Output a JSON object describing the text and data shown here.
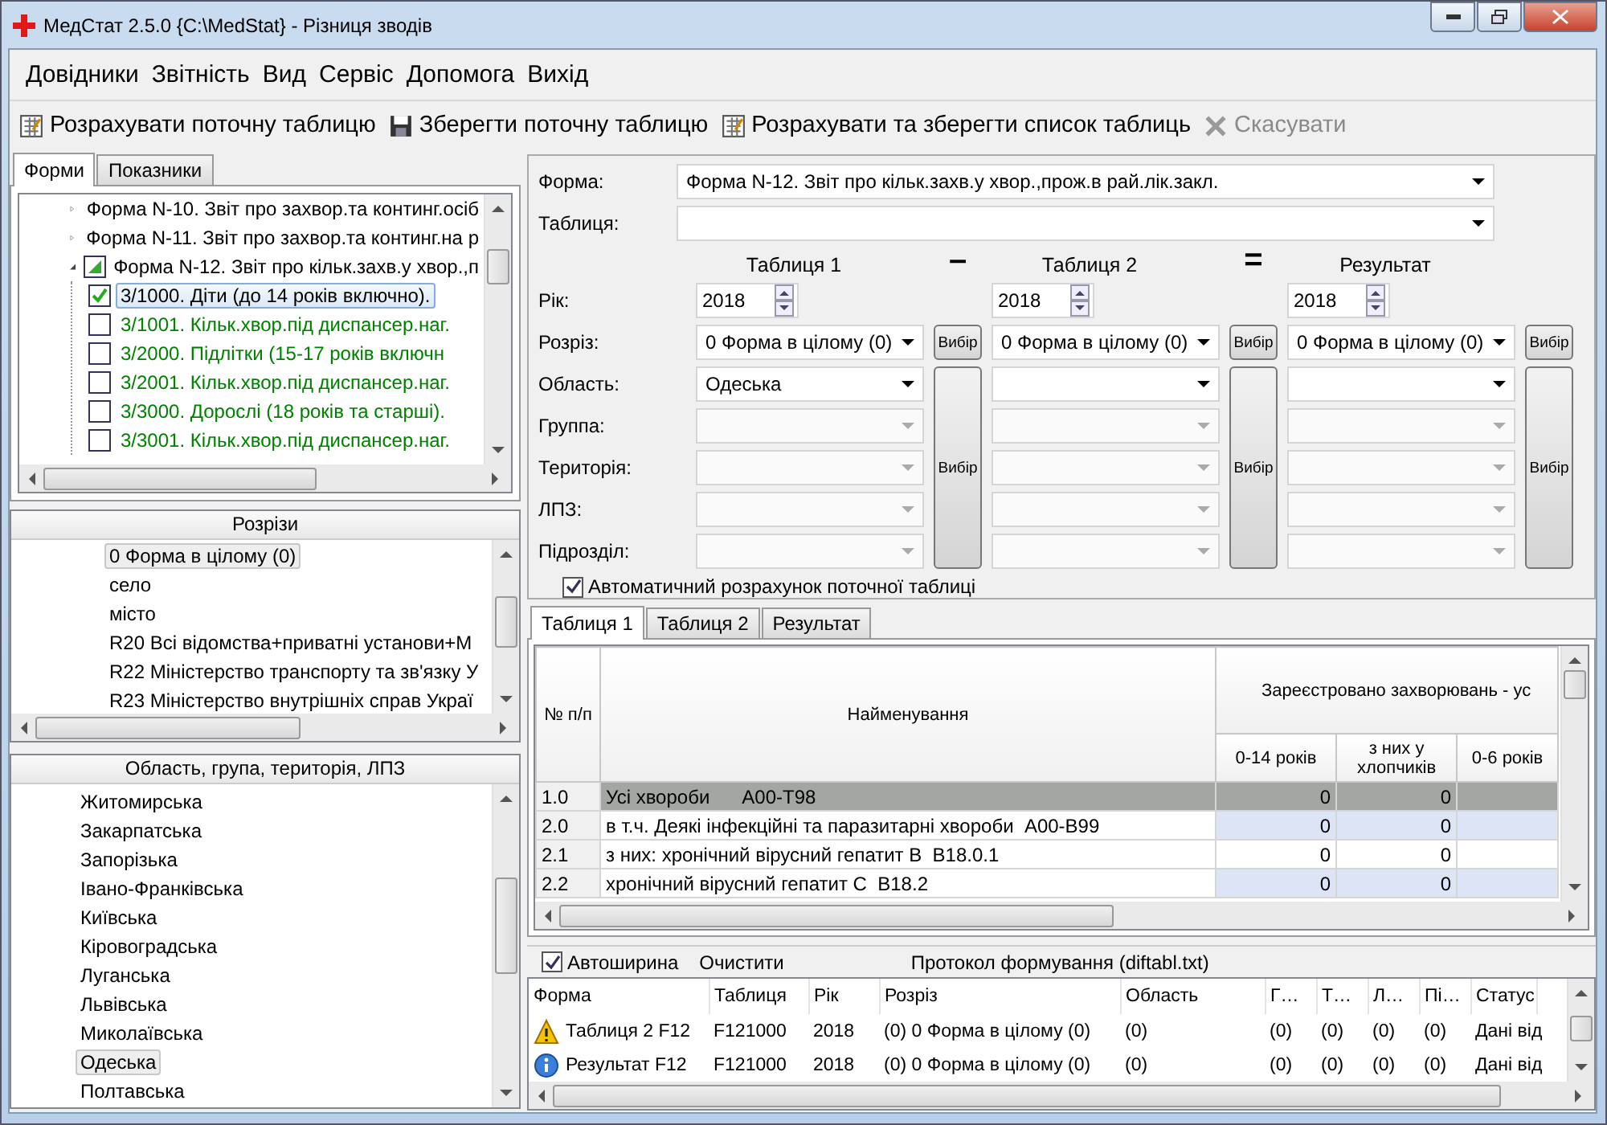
{
  "window": {
    "title": "МедСтат 2.5.0  {C:\\MedStat} - Різниця зводів"
  },
  "menu": [
    "Довідники",
    "Звітність",
    "Вид",
    "Сервіс",
    "Допомога",
    "Вихід"
  ],
  "toolbar": [
    {
      "kind": "calculate",
      "label": "Розрахувати поточну таблицю",
      "disabled": false
    },
    {
      "kind": "save",
      "label": "Зберегти поточну таблицю",
      "disabled": false
    },
    {
      "kind": "calculate",
      "label": "Розрахувати та зберегти список таблиць",
      "disabled": false
    },
    {
      "kind": "cancel",
      "label": "Скасувати",
      "disabled": true
    }
  ],
  "left_tabs": [
    {
      "label": "Форми",
      "selected": true
    },
    {
      "label": "Показники",
      "selected": false
    }
  ],
  "forms_tree": [
    {
      "label": "Форма N-10. Звіт про захвор.та континг.осіб",
      "expanded": false
    },
    {
      "label": "Форма N-11. Звіт про захвор.та континг.на р",
      "expanded": false
    },
    {
      "label": "Форма N-12. Звіт про кільк.захв.у хвор.,п",
      "expanded": true,
      "partial": true,
      "children": [
        {
          "label": "3/1000. Діти (до 14 років включно).",
          "checked": true,
          "selected": true,
          "color": "#000000"
        },
        {
          "label": "3/1001. Кільк.хвор.під диспансер.наг.",
          "checked": false,
          "selected": false,
          "color": "#008000"
        },
        {
          "label": "3/2000. Підлітки (15-17 років включн",
          "checked": false,
          "selected": false,
          "color": "#008000"
        },
        {
          "label": "3/2001. Кільк.хвор.під диспансер.наг.",
          "checked": false,
          "selected": false,
          "color": "#008000"
        },
        {
          "label": "3/3000. Дорослі (18 років та старші).",
          "checked": false,
          "selected": false,
          "color": "#008000"
        },
        {
          "label": "3/3001. Кільк.хвор.під диспансер.наг.",
          "checked": false,
          "selected": false,
          "color": "#008000"
        }
      ]
    }
  ],
  "slices": {
    "title": "Розрізи",
    "items": [
      {
        "label": "0 Форма в цілому (0)",
        "selected": true
      },
      {
        "label": "село",
        "selected": false
      },
      {
        "label": "місто",
        "selected": false
      },
      {
        "label": "R20 Всі відомства+приватні установи+М",
        "selected": false
      },
      {
        "label": "R22 Міністерство транспорту та зв'язку У",
        "selected": false
      },
      {
        "label": "R23 Міністерство внутрішніх справ Украї",
        "selected": false
      }
    ]
  },
  "regions": {
    "title": "Область, група, територія, ЛПЗ",
    "items": [
      {
        "label": "Житомирська",
        "selected": false
      },
      {
        "label": "Закарпатська",
        "selected": false
      },
      {
        "label": "Запорізька",
        "selected": false
      },
      {
        "label": "Івано-Франківська",
        "selected": false
      },
      {
        "label": "Київська",
        "selected": false
      },
      {
        "label": "Кіровоградська",
        "selected": false
      },
      {
        "label": "Луганська",
        "selected": false
      },
      {
        "label": "Львівська",
        "selected": false
      },
      {
        "label": "Миколаївська",
        "selected": false
      },
      {
        "label": "Одеська",
        "selected": true
      },
      {
        "label": "Полтавська",
        "selected": false
      }
    ]
  },
  "form": {
    "form_label": "Форма:",
    "form_value": "Форма N-12. Звіт про кільк.захв.у хвор.,прож.в рай.лік.закл.",
    "table_label": "Таблиця:"
  },
  "compare": {
    "operators": [
      "–",
      "="
    ],
    "labels": [
      "Рік:",
      "Розріз:",
      "Область:",
      "Группа:",
      "Територія:",
      "ЛПЗ:",
      "Підрозділ:"
    ],
    "columns": [
      {
        "title": "Таблиця 1",
        "year": "2018",
        "slice": "0 Форма в цілому (0)",
        "slice_button": "Вибір",
        "select_button": "Вибір",
        "fields": [
          {
            "value": "Одеська",
            "disabled": false
          },
          {
            "disabled": true
          },
          {
            "disabled": true
          },
          {
            "disabled": true
          },
          {
            "disabled": true
          }
        ]
      },
      {
        "title": "Таблиця 2",
        "year": "2018",
        "slice": "0 Форма в цілому (0)",
        "slice_button": "Вибір",
        "select_button": "Вибір",
        "fields": [
          {
            "disabled": false
          },
          {
            "disabled": true
          },
          {
            "disabled": true
          },
          {
            "disabled": true
          },
          {
            "disabled": true
          }
        ]
      },
      {
        "title": "Результат",
        "year": "2018",
        "slice": "0 Форма в цілому (0)",
        "slice_button": "Вибір",
        "select_button": "Вибір",
        "fields": [
          {
            "disabled": false
          },
          {
            "disabled": true
          },
          {
            "disabled": true
          },
          {
            "disabled": true
          },
          {
            "disabled": true
          }
        ]
      }
    ],
    "auto_calc": {
      "label": "Автоматичний розрахунок поточної таблиці",
      "checked": true
    }
  },
  "table_tabs": [
    {
      "label": "Таблиця 1",
      "selected": true
    },
    {
      "label": "Таблиця 2",
      "selected": false
    },
    {
      "label": "Результат",
      "selected": false
    }
  ],
  "grid": {
    "number_header": "№ п/п",
    "name_header": "Найменування",
    "group_header": "Зареєстровано захворювань - ус",
    "sub_headers": [
      "0-14 років",
      "з них у хлопчиків",
      "0-6 років"
    ],
    "rows": [
      {
        "number": "1.0",
        "name": "Усі хвороби      A00-T98",
        "values": [
          "0",
          "0"
        ],
        "selected": true
      },
      {
        "number": "2.0",
        "name": "в т.ч. Деякі інфекційні та паразитарні хвороби  A00-B99",
        "values": [
          "0",
          "0"
        ],
        "selected": false
      },
      {
        "number": "2.1",
        "name": "з них: хронічний вірусний гепатит В  B18.0.1",
        "values": [
          "0",
          "0"
        ],
        "selected": false
      },
      {
        "number": "2.2",
        "name": "хронічний вірусний гепатит С  B18.2",
        "values": [
          "0",
          "0"
        ],
        "selected": false
      }
    ]
  },
  "log": {
    "autowidth": {
      "label": "Автоширина",
      "checked": true
    },
    "clear_button": "Очистити",
    "title": "Протокол формування (diftabl.txt)",
    "columns": [
      "Форма",
      "Таблиця",
      "Рік",
      "Розріз",
      "Область",
      "Г…",
      "Т…",
      "Л…",
      "Пі…",
      "Статус"
    ],
    "rows": [
      {
        "kind": "warning",
        "cells": [
          "Таблиця 2 F12",
          "F121000",
          "2018",
          "(0) 0 Форма в цілому (0)",
          "(0)",
          "(0)",
          "(0)",
          "(0)",
          "(0)",
          "Дані від"
        ]
      },
      {
        "kind": "info",
        "cells": [
          "Результат F12",
          "F121000",
          "2018",
          "(0) 0 Форма в цілому (0)",
          "(0)",
          "(0)",
          "(0)",
          "(0)",
          "(0)",
          "Дані від"
        ]
      }
    ]
  }
}
